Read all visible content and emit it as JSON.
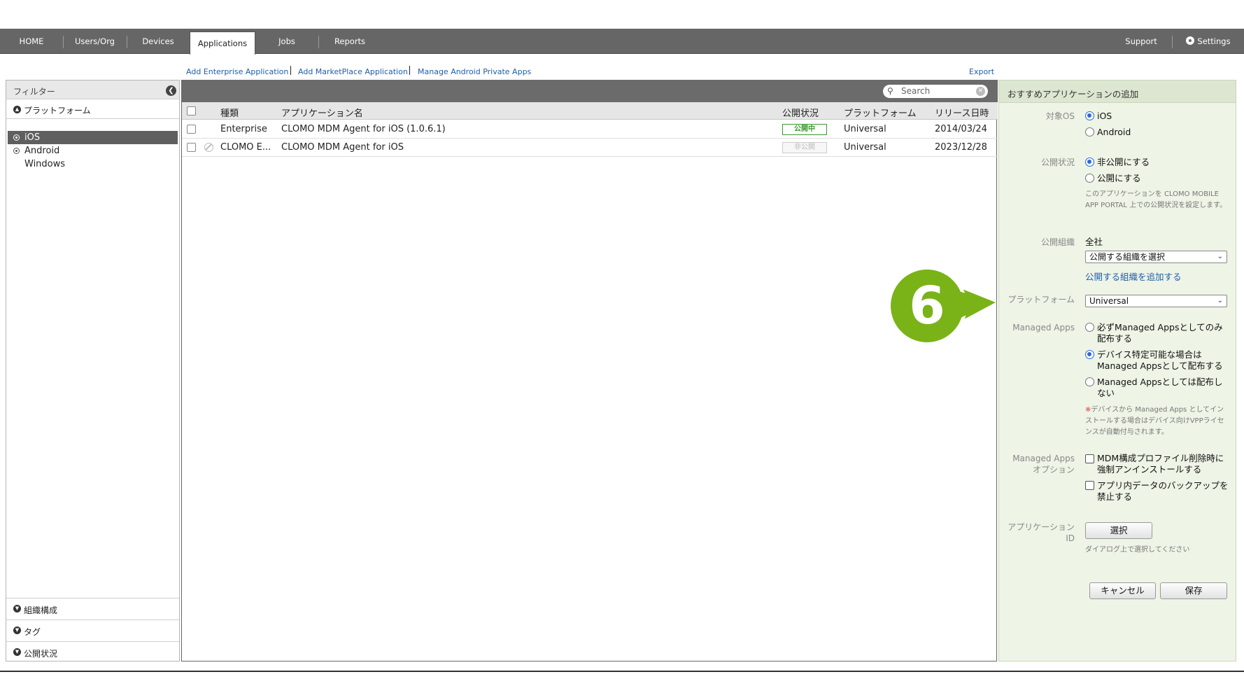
{
  "nav": {
    "items": [
      {
        "label": "HOME"
      },
      {
        "label": "Users/Org"
      },
      {
        "label": "Devices"
      },
      {
        "label": "Applications",
        "active": true
      },
      {
        "label": "Jobs"
      },
      {
        "label": "Reports"
      }
    ],
    "support_label": "Support",
    "settings_label": "Settings"
  },
  "actions": {
    "add_enterprise": "Add Enterprise Application",
    "add_marketplace": "Add MarketPlace Application",
    "manage_android": "Manage Android Private Apps",
    "export": "Export"
  },
  "filter": {
    "title": "フィルター",
    "platform_header": "プラットフォーム",
    "platforms": [
      {
        "label": "iOS",
        "selected": true
      },
      {
        "label": "Android",
        "selected": false
      },
      {
        "label": "Windows",
        "selected": false
      }
    ],
    "org_header": "組織構成",
    "tag_header": "タグ",
    "status_header": "公開状況"
  },
  "table": {
    "search_placeholder": "Search",
    "columns": {
      "type": "種類",
      "name": "アプリケーション名",
      "status": "公開状況",
      "platform": "プラットフォーム",
      "release": "リリース日時"
    },
    "rows": [
      {
        "type": "Enterprise",
        "name": "CLOMO MDM Agent for iOS (1.0.6.1)",
        "status": "公開中",
        "platform": "Universal",
        "release": "2014/03/24",
        "disabled": false
      },
      {
        "type": "CLOMO E...",
        "name": "CLOMO MDM Agent for iOS",
        "status": "非公開",
        "platform": "Universal",
        "release": "2023/12/28",
        "disabled": true
      }
    ]
  },
  "form": {
    "title": "おすすめアプリケーションの追加",
    "os_label": "対象OS",
    "os_options": [
      "iOS",
      "Android"
    ],
    "os_selected": "iOS",
    "status_label": "公開状況",
    "status_options": [
      "非公開にする",
      "公開にする"
    ],
    "status_selected": "非公開にする",
    "status_note": "このアプリケーションを CLOMO MOBILE APP PORTAL 上での公開状況を設定します。",
    "org_label": "公開組織",
    "org_value": "全社",
    "org_select": "公開する組織を選択",
    "org_add_link": "公開する組織を追加する",
    "platform_label": "プラットフォーム",
    "platform_value": "Universal",
    "managed_label": "Managed Apps",
    "managed_opt1": "必ずManaged Appsとしてのみ配布する",
    "managed_opt2": "デバイス特定可能な場合はManaged Appsとして配布する",
    "managed_opt3": "Managed Appsとしては配布しない",
    "managed_selected": 2,
    "managed_note_mark": "※",
    "managed_note": "デバイスから Managed Apps としてインストールする場合はデバイス向けVPPライセンスが自動付与されます。",
    "managed_opt_label": "Managed Apps オプション",
    "check1": "MDM構成プロファイル削除時に強制アンインストールする",
    "check2": "アプリ内データのバックアップを禁止する",
    "appid_label": "アプリケーション ID",
    "select_button": "選択",
    "appid_note": "ダイアログ上で選択してください",
    "cancel_button": "キャンセル",
    "save_button": "保存"
  },
  "marker": {
    "number": "6",
    "color": "#7ab317"
  }
}
